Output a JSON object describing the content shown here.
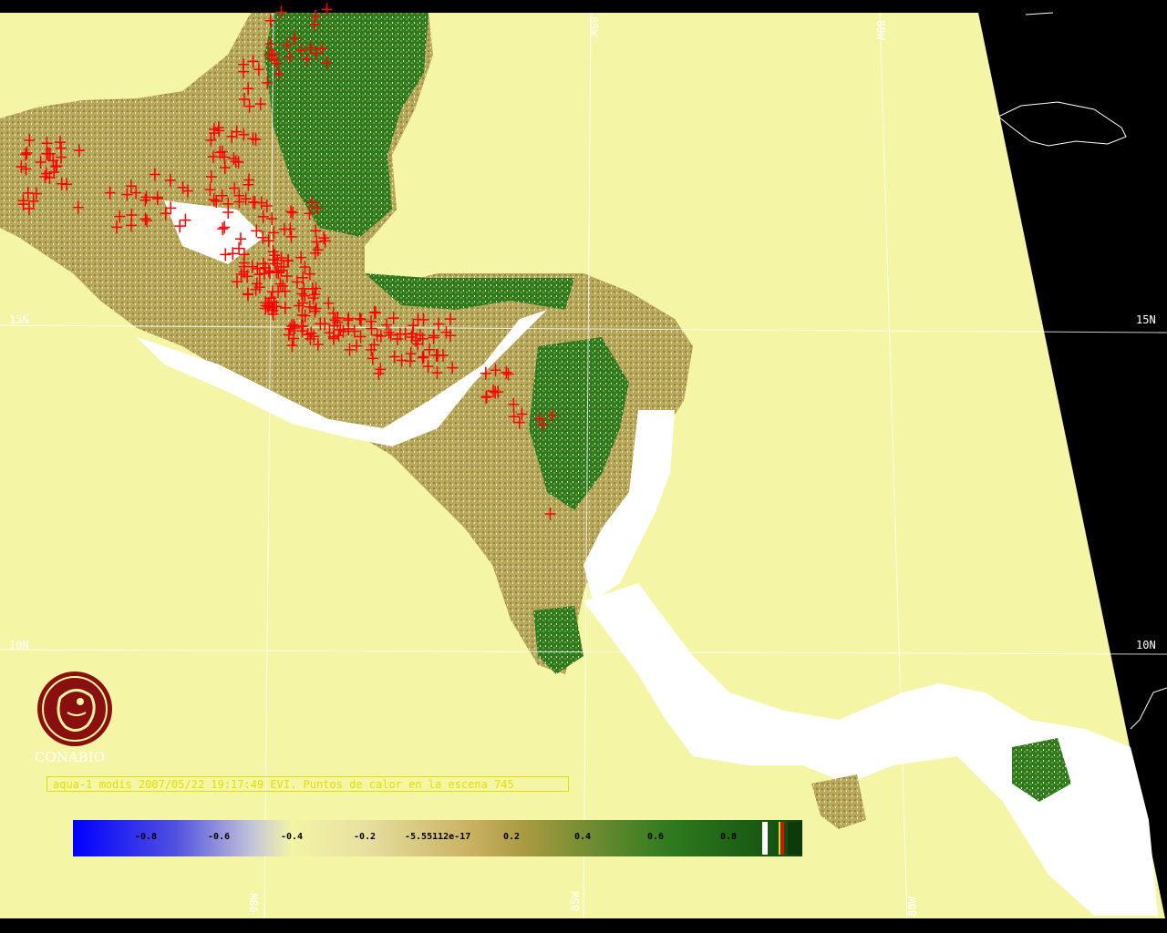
{
  "caption": "aqua-1 modis 2007/05/22 19:17:49 EVI. Puntos de calor en la escena 745",
  "logo_text": "CONABIO",
  "lat_labels": {
    "lat15": "15N",
    "lat10": "10N"
  },
  "lon_labels": {
    "lon85": "85W",
    "lon80": "80W",
    "lon90": "90W"
  },
  "colorbar": {
    "labels": [
      "-0.8",
      "-0.6",
      "-0.4",
      "-0.2",
      "-5.55112e-17",
      "0.2",
      "0.4",
      "0.6",
      "0.8"
    ],
    "colors": {
      "low": "#0000ff",
      "mid_low": "#f3f4a6",
      "zero": "#b89a50",
      "high": "#0d4a0d"
    }
  },
  "colors": {
    "ocean": "#f5f5a6",
    "background": "#000000",
    "fire_marker": "#ff0000",
    "cloud": "#ffffff",
    "caption": "#e0e000"
  }
}
